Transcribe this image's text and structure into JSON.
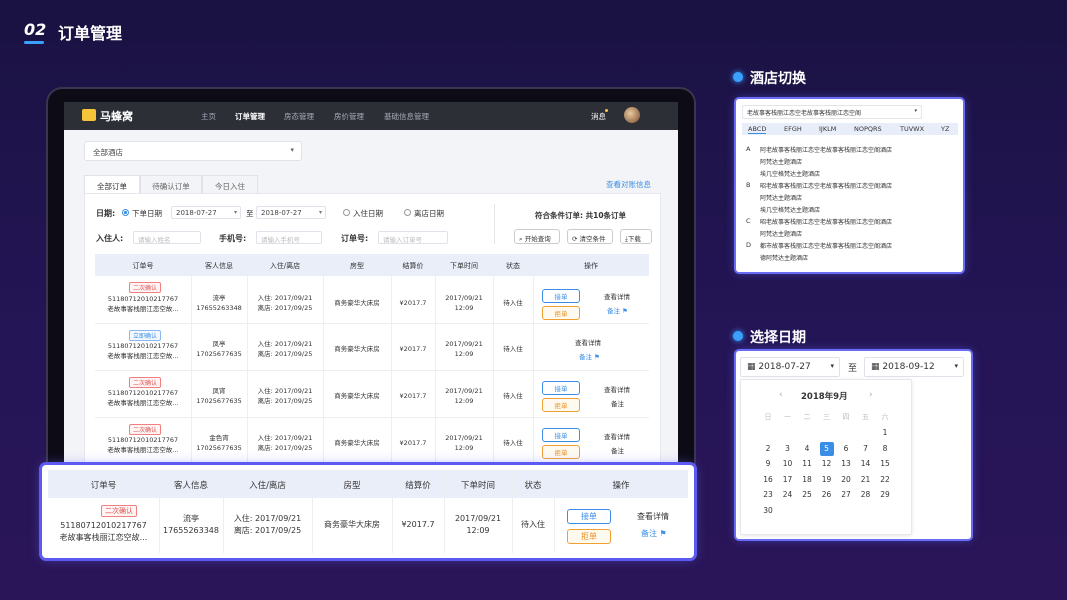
{
  "section": {
    "number": "02",
    "title": "订单管理"
  },
  "app": {
    "logo": "马蜂窝",
    "nav": [
      "主页",
      "订单管理",
      "房态管理",
      "房价管理",
      "基础信息管理"
    ],
    "nav_active": "订单管理",
    "message": "消息",
    "hotel_select": "全部酒店",
    "tabs": [
      "全部订单",
      "待确认订单",
      "今日入住"
    ],
    "reconcile_link": "查看对账信息",
    "filters": {
      "date_label": "日期:",
      "order_date": "下单日期",
      "start_date": "2018-07-27",
      "to": "至",
      "end_date": "2018-07-27",
      "checkin_date": "入住日期",
      "checkout_date": "离店日期",
      "guest_label": "入住人:",
      "guest_placeholder": "请输入姓名",
      "phone_label": "手机号:",
      "phone_placeholder": "请输入手机号",
      "order_label": "订单号:",
      "order_placeholder": "请输入订单号",
      "match_text": "符合条件订单: 共10条订单",
      "search_btn": "开始查询",
      "clear_btn": "清空条件",
      "download_btn": "下载"
    },
    "table_headers": [
      "订单号",
      "客人信息",
      "入住/离店",
      "房型",
      "结算价",
      "下单时间",
      "状态",
      "操作"
    ],
    "rows": [
      {
        "badge": "二次确认",
        "badge_color": "red",
        "order_no": "51180712010217767",
        "hotel": "老故事客栈丽江恋空故...",
        "guest": "流亭",
        "phone": "17655263348",
        "checkin": "入住: 2017/09/21",
        "checkout": "离店: 2017/09/25",
        "room": "商务豪华大床房",
        "price": "¥2017.7",
        "date": "2017/09/21",
        "time": "12:09",
        "status": "待入住",
        "accept": "接单",
        "reject": "拒单",
        "detail": "查看详情",
        "note": "备注"
      },
      {
        "badge": "立即确认",
        "badge_color": "blue",
        "order_no": "51180712010217767",
        "hotel": "老故事客栈丽江恋空故...",
        "guest": "凤亭",
        "phone": "17025677635",
        "checkin": "入住: 2017/09/21",
        "checkout": "离店: 2017/09/25",
        "room": "商务豪华大床房",
        "price": "¥2017.7",
        "date": "2017/09/21",
        "time": "12:09",
        "status": "待入住",
        "detail": "查看详情",
        "note": "备注"
      },
      {
        "badge": "二次确认",
        "badge_color": "red",
        "order_no": "51180712010217767",
        "hotel": "老故事客栈丽江恋空故...",
        "guest": "凤宵",
        "phone": "17025677635",
        "checkin": "入住: 2017/09/21",
        "checkout": "离店: 2017/09/25",
        "room": "商务豪华大床房",
        "price": "¥2017.7",
        "date": "2017/09/21",
        "time": "12:09",
        "status": "待入住",
        "accept": "接单",
        "reject": "拒单",
        "detail": "查看详情",
        "note": "备注"
      },
      {
        "badge": "二次确认",
        "badge_color": "red",
        "order_no": "51180712010217767",
        "hotel": "老故事客栈丽江恋空故...",
        "guest": "金色宵",
        "phone": "17025677635",
        "checkin": "入住: 2017/09/21",
        "checkout": "离店: 2017/09/25",
        "room": "商务豪华大床房",
        "price": "¥2017.7",
        "date": "2017/09/21",
        "time": "12:09",
        "status": "待入住",
        "accept": "接单",
        "reject": "拒单",
        "detail": "查看详情",
        "note": "备注"
      }
    ]
  },
  "zoom_row": {
    "badge": "二次确认",
    "order_no": "51180712010217767",
    "hotel": "老故事客栈丽江恋空故...",
    "guest": "流亭",
    "phone": "17655263348",
    "checkin": "入住: 2017/09/21",
    "checkout": "离店: 2017/09/25",
    "room": "商务豪华大床房",
    "price": "¥2017.7",
    "date": "2017/09/21",
    "time": "12:09",
    "status": "待入住",
    "accept": "接单",
    "reject": "拒单",
    "detail": "查看详情",
    "note": "备注"
  },
  "hotel_switch": {
    "heading": "酒店切换",
    "selected": "老故事客栈丽江恋空老故事客栈丽江恋空阁",
    "tabs": [
      "ABCD",
      "EFGH",
      "IJKLM",
      "NOPQRS",
      "TUVWX",
      "YZ"
    ],
    "groups": [
      {
        "letter": "A",
        "items": [
          "阿老故事客栈丽江恋空老故事客栈丽江恋空阁酒店",
          "阿梵达主题酒店",
          "埃几空格梵达主题酒店"
        ]
      },
      {
        "letter": "B",
        "items": [
          "昭老故事客栈丽江恋空老故事客栈丽江恋空阁酒店",
          "阿梵达主题酒店",
          "埃几空格梵达主题酒店"
        ]
      },
      {
        "letter": "C",
        "items": [
          "昭老故事客栈丽江恋空老故事客栈丽江恋空阁酒店",
          "阿梵达主题酒店"
        ]
      },
      {
        "letter": "D",
        "items": [
          "都市故事客栈丽江恋空老故事客栈丽江恋空阁酒店",
          "德阿梵达主题酒店"
        ]
      }
    ]
  },
  "date_picker": {
    "heading": "选择日期",
    "start": "2018-07-27",
    "to": "至",
    "end": "2018-09-12",
    "month": "2018年9月",
    "weekdays": [
      "日",
      "一",
      "二",
      "三",
      "四",
      "五",
      "六"
    ],
    "selected_day": "5",
    "weeks": [
      [
        "",
        "",
        "",
        "",
        "",
        "",
        "1"
      ],
      [
        "2",
        "3",
        "4",
        "5",
        "6",
        "7",
        "8"
      ],
      [
        "9",
        "10",
        "11",
        "12",
        "13",
        "14",
        "15"
      ],
      [
        "16",
        "17",
        "18",
        "19",
        "20",
        "21",
        "22"
      ],
      [
        "23",
        "24",
        "25",
        "26",
        "27",
        "28",
        "29"
      ],
      [
        "30",
        "",
        "",
        "",
        "",
        "",
        ""
      ]
    ]
  }
}
